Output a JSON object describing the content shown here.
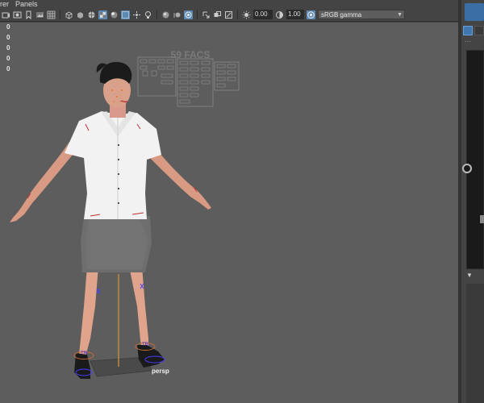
{
  "menu": {
    "item_renderer": "rer",
    "item_panels": "Panels"
  },
  "toolbar": {
    "field_1": "0.00",
    "field_2": "1.00",
    "color_space": "sRGB gamma"
  },
  "hud": {
    "stats": [
      "0",
      "0",
      "0",
      "0",
      "0"
    ]
  },
  "viewport": {
    "camera_label": "persp",
    "facs_panel_title": "59 FACS",
    "manip_label_left": "TR",
    "manip_label_right": "TR"
  },
  "colors": {
    "viewport_bg": "#5d5d5d",
    "ui_bg": "#444444",
    "active_icon": "#5c8ab3",
    "manip_blue": "#4a3cff"
  }
}
